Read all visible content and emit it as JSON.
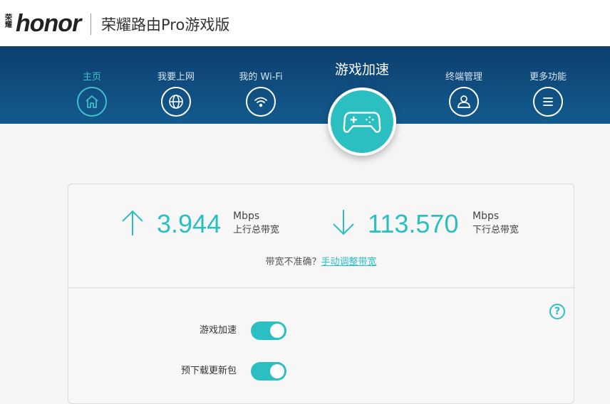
{
  "header": {
    "logo_cn": "荣耀",
    "logo_brand": "honor",
    "app_title": "荣耀路由Pro游戏版"
  },
  "nav": {
    "items": [
      {
        "label": "主页",
        "icon": "home-icon",
        "active": true
      },
      {
        "label": "我要上网",
        "icon": "globe-icon"
      },
      {
        "label": "我的 Wi-Fi",
        "icon": "wifi-icon"
      },
      {
        "label": "游戏加速",
        "icon": "gamepad-icon",
        "featured": true
      },
      {
        "label": "终端管理",
        "icon": "user-icon"
      },
      {
        "label": "更多功能",
        "icon": "menu-icon"
      }
    ]
  },
  "bandwidth": {
    "upload": {
      "value": "3.944",
      "unit": "Mbps",
      "desc": "上行总带宽"
    },
    "download": {
      "value": "113.570",
      "unit": "Mbps",
      "desc": "下行总带宽"
    },
    "hint_text": "带宽不准确？",
    "hint_link": "手动调整带宽"
  },
  "settings": {
    "help_icon": "?",
    "game_accel": {
      "label": "游戏加速",
      "on": true
    },
    "preload_update": {
      "label": "预下载更新包",
      "on": true
    }
  },
  "colors": {
    "accent": "#2bbfc2",
    "nav_bg": "#0d3f6e",
    "brand_red": "#e8272a"
  }
}
